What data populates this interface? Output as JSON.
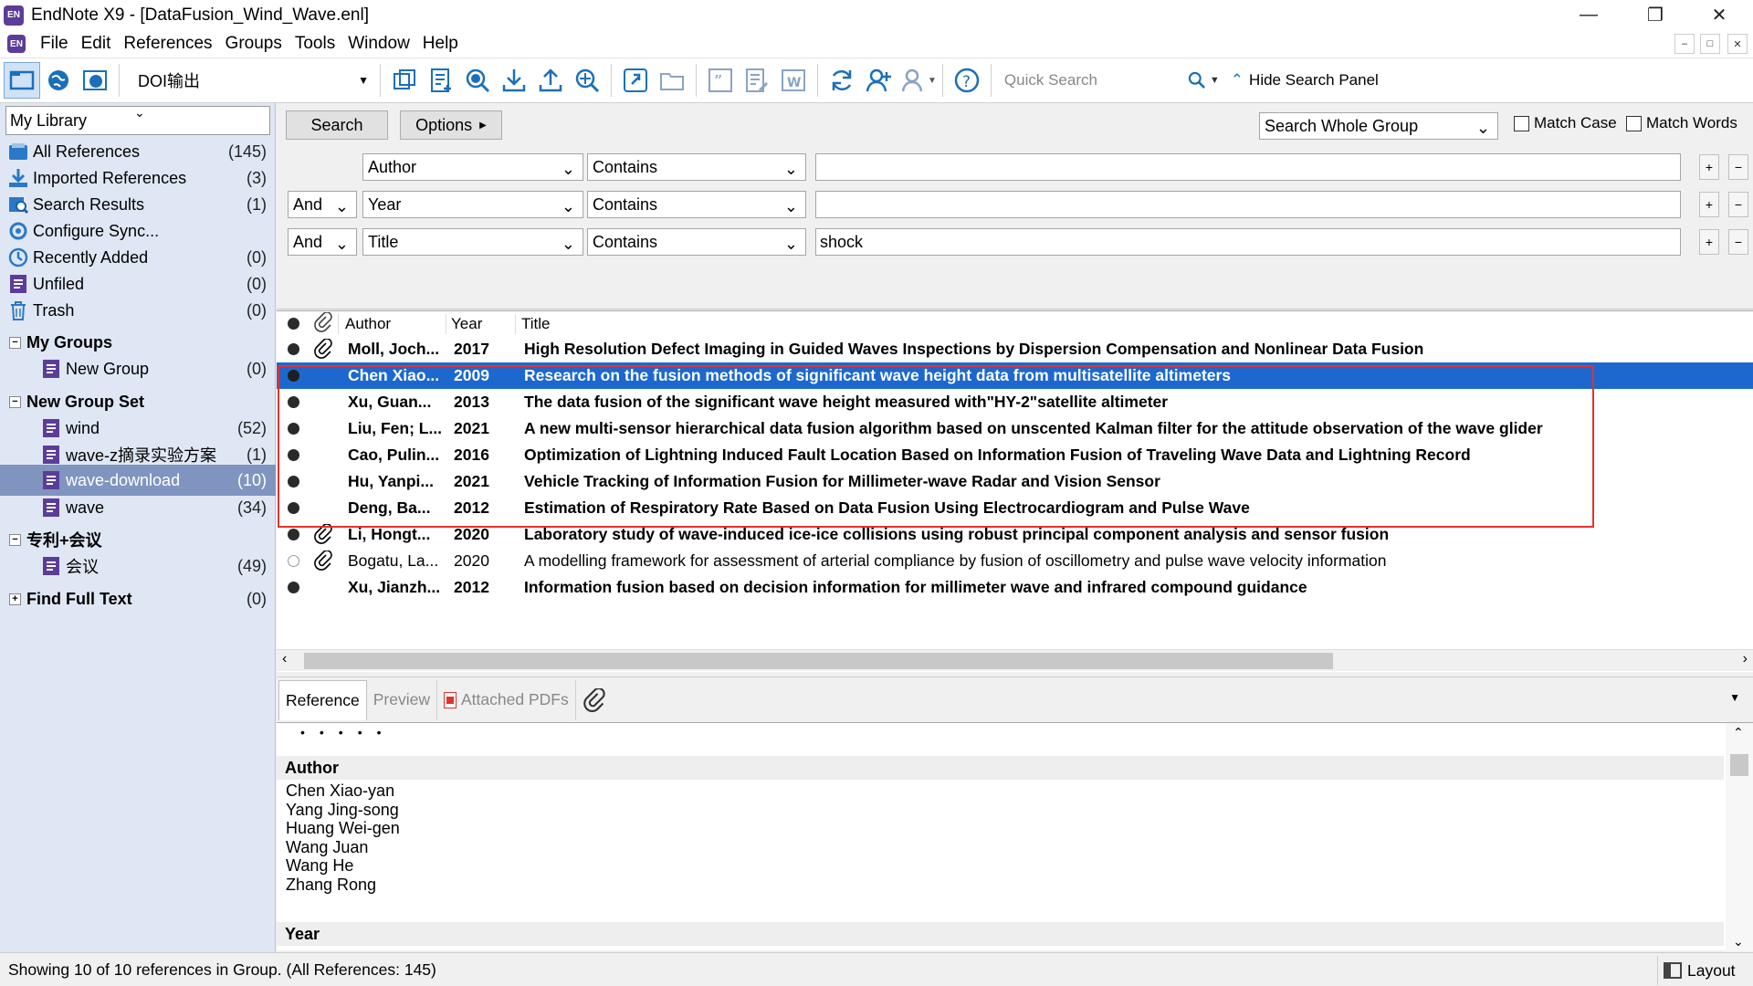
{
  "window": {
    "title": "EndNote X9 - [DataFusion_Wind_Wave.enl]",
    "icon_text": "EN",
    "controls": [
      "minimize",
      "restore",
      "close"
    ]
  },
  "menu": [
    "File",
    "Edit",
    "References",
    "Groups",
    "Tools",
    "Window",
    "Help"
  ],
  "toolbar": {
    "style": "DOI输出",
    "quick_search_placeholder": "Quick Search",
    "hide_search_label": "Hide Search Panel"
  },
  "sidebar": {
    "library_label": "My Library",
    "items": [
      {
        "label": "All References",
        "count": "(145)",
        "icon": "all-references-icon"
      },
      {
        "label": "Imported References",
        "count": "(3)",
        "icon": "import-icon"
      },
      {
        "label": "Search Results",
        "count": "(1)",
        "icon": "search-results-icon"
      },
      {
        "label": "Configure Sync...",
        "count": "",
        "icon": "sync-icon"
      },
      {
        "label": "Recently Added",
        "count": "(0)",
        "icon": "clock-icon"
      },
      {
        "label": "Unfiled",
        "count": "(0)",
        "icon": "group-icon"
      },
      {
        "label": "Trash",
        "count": "(0)",
        "icon": "trash-icon"
      }
    ],
    "my_groups": {
      "label": "My Groups",
      "items": [
        {
          "label": "New Group",
          "count": "(0)"
        }
      ]
    },
    "new_group_set": {
      "label": "New Group Set",
      "items": [
        {
          "label": "wind",
          "count": "(52)"
        },
        {
          "label": "wave-z摘录实验方案",
          "count": "(1)"
        },
        {
          "label": "wave-download",
          "count": "(10)"
        },
        {
          "label": "wave",
          "count": "(34)"
        }
      ]
    },
    "patent_set": {
      "label": "专利+会议",
      "items": [
        {
          "label": "会议",
          "count": "(49)"
        }
      ]
    },
    "find_full_text": {
      "label": "Find Full Text",
      "count": "(0)"
    }
  },
  "search": {
    "search_button": "Search",
    "options_button": "Options",
    "scope": "Search Whole Group",
    "match_case": "Match Case",
    "match_words": "Match Words",
    "rows": [
      {
        "bool": "",
        "field": "Author",
        "op": "Contains",
        "value": ""
      },
      {
        "bool": "And",
        "field": "Year",
        "op": "Contains",
        "value": ""
      },
      {
        "bool": "And",
        "field": "Title",
        "op": "Contains",
        "value": "shock"
      }
    ]
  },
  "references": {
    "columns": {
      "author": "Author",
      "year": "Year",
      "title": "Title"
    },
    "rows": [
      {
        "author": "Moll, Joch...",
        "year": "2017",
        "title": "High Resolution Defect Imaging in Guided Waves Inspections by Dispersion Compensation and Nonlinear Data Fusion",
        "unread": true,
        "attachment": true
      },
      {
        "author": "Chen Xiao...",
        "year": "2009",
        "title": "Research on the fusion methods of significant wave height data from multisatellite altimeters",
        "unread": true,
        "attachment": false
      },
      {
        "author": "Xu, Guan...",
        "year": "2013",
        "title": "The data fusion of the significant wave height measured with\"HY-2\"satellite altimeter",
        "unread": true,
        "attachment": false
      },
      {
        "author": "Liu, Fen; L...",
        "year": "2021",
        "title": "A new multi-sensor hierarchical data fusion algorithm based on unscented Kalman filter for the attitude observation of the wave glider",
        "unread": true,
        "attachment": false
      },
      {
        "author": "Cao, Pulin...",
        "year": "2016",
        "title": "Optimization of Lightning Induced Fault Location Based on Information Fusion of Traveling Wave Data and Lightning Record",
        "unread": true,
        "attachment": false
      },
      {
        "author": "Hu, Yanpi...",
        "year": "2021",
        "title": "Vehicle Tracking of Information Fusion for Millimeter-wave Radar and Vision Sensor",
        "unread": true,
        "attachment": false
      },
      {
        "author": "Deng, Ba...",
        "year": "2012",
        "title": "Estimation of Respiratory Rate Based on Data Fusion Using Electrocardiogram and Pulse Wave",
        "unread": true,
        "attachment": false
      },
      {
        "author": "Li, Hongt...",
        "year": "2020",
        "title": "Laboratory study of wave-induced ice-ice collisions using robust principal component analysis and sensor fusion",
        "unread": true,
        "attachment": true
      },
      {
        "author": "Bogatu, La...",
        "year": "2020",
        "title": "A modelling framework for assessment of arterial compliance by fusion of oscillometry and pulse wave velocity information",
        "unread": false,
        "attachment": true
      },
      {
        "author": "Xu, Jianzh...",
        "year": "2012",
        "title": "Information fusion based on decision information for millimeter wave and infrared compound guidance",
        "unread": true,
        "attachment": false
      }
    ],
    "selected_index": 1
  },
  "preview": {
    "tabs": [
      "Reference",
      "Preview",
      "Attached PDFs"
    ],
    "author_heading": "Author",
    "authors": [
      "Chen Xiao-yan",
      "Yang Jing-song",
      "Huang Wei-gen",
      "Wang Juan",
      "Wang He",
      "Zhang Rong"
    ],
    "year_heading": "Year"
  },
  "status": {
    "text": "Showing 10 of 10 references in Group. (All References: 145)",
    "layout_label": "Layout"
  },
  "colors": {
    "selection": "#1c68cf",
    "sidebar_bg": "#dfe7f4",
    "sidebar_selected": "#8094c0",
    "highlight_box": "#e53030",
    "group_icon": "#5b3d99"
  }
}
